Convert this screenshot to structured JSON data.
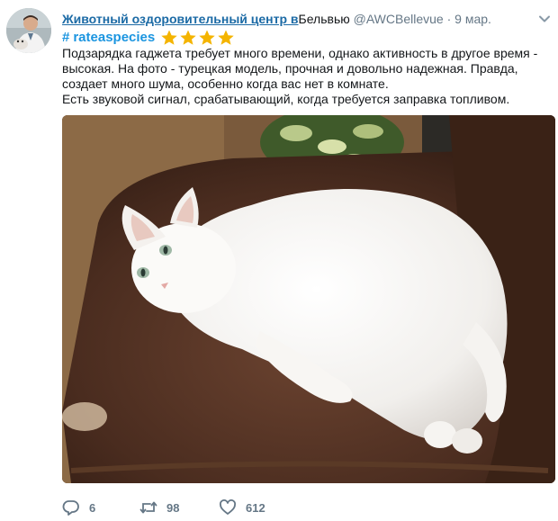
{
  "tweet": {
    "display_name": "Животный оздоровительный центр в",
    "location": "Бельвью",
    "handle": "@AWCBellevue",
    "separator": "·",
    "date": "9 мар.",
    "hashtag": "rateaspecies",
    "hash_symbol": "#",
    "rating_stars": 4,
    "text_lines": [
      "Подзарядка гаджета требует много времени, однако активность в другое время - высокая. На фото - турецкая модель, прочная и довольно надежная. Правда, создает много шума, особенно когда вас нет в комнате.",
      "Есть звуковой сигнал, срабатывающий, когда требуется заправка топливом."
    ]
  },
  "actions": {
    "reply_count": "6",
    "retweet_count": "98",
    "like_count": "612"
  },
  "icons": {
    "avatar": "avatar",
    "caret": "chevron-down-icon",
    "star": "star-icon",
    "reply": "reply-icon",
    "retweet": "retweet-icon",
    "like": "heart-icon"
  },
  "colors": {
    "display_name": "#1b6aa5",
    "hashtag": "#1b95e0",
    "muted": "#657786",
    "star": "#f4b400",
    "text": "#14171a"
  }
}
